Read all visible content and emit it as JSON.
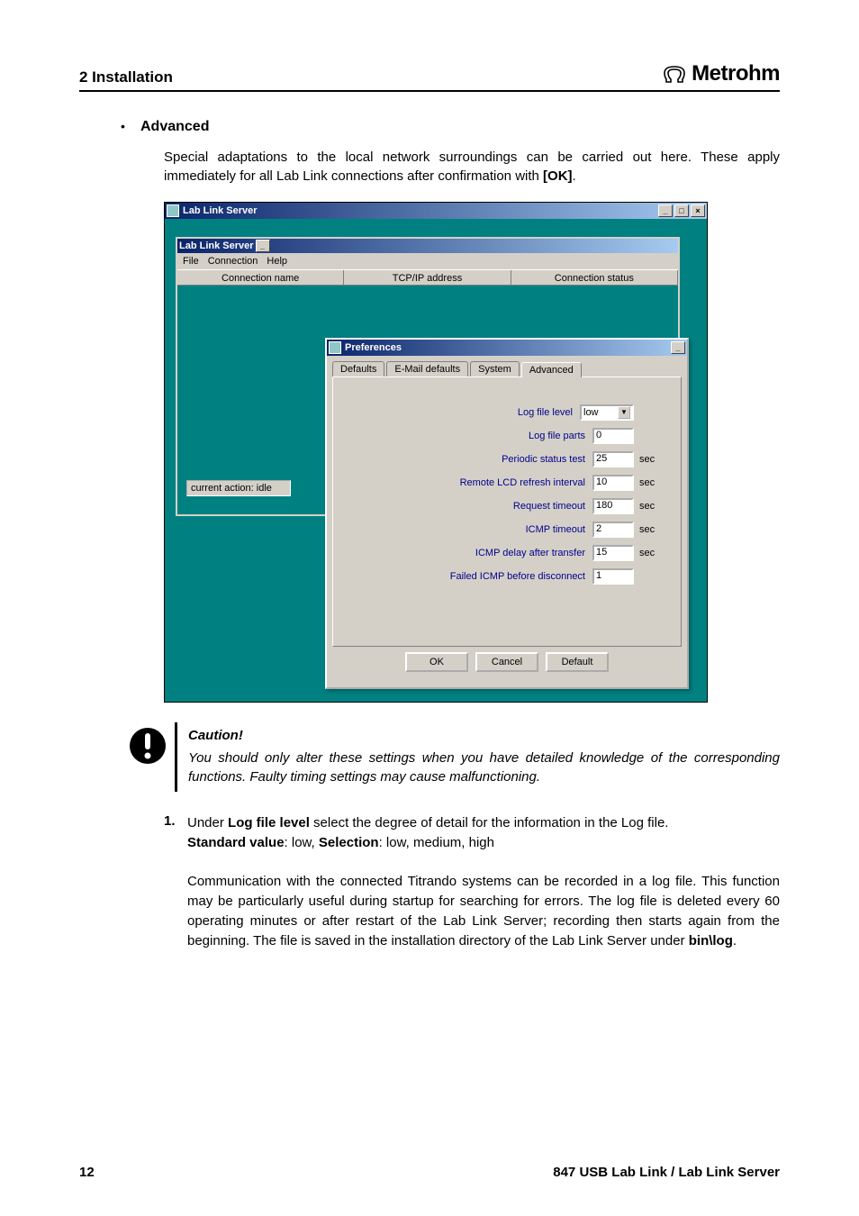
{
  "header": {
    "section": "2 Installation",
    "brand": "Metrohm"
  },
  "bullet": {
    "label": "Advanced"
  },
  "intro": "Special adaptations to the local network surroundings can be carried out here. These apply immediately for all Lab Link connections after confirmation with ",
  "intro_bold": "[OK]",
  "intro_tail": ".",
  "outer_window": {
    "title": "Lab Link Server"
  },
  "inner_window": {
    "title": "Lab Link Server",
    "menu": [
      "File",
      "Connection",
      "Help"
    ],
    "columns": [
      "Connection name",
      "TCP/IP address",
      "Connection status"
    ],
    "status": "current action:   idle"
  },
  "prefs": {
    "title": "Preferences",
    "tabs": [
      "Defaults",
      "E-Mail defaults",
      "System",
      "Advanced"
    ],
    "active_tab": 3,
    "fields": [
      {
        "label": "Log file level",
        "type": "select",
        "value": "low",
        "unit": ""
      },
      {
        "label": "Log file parts",
        "type": "input",
        "value": "0",
        "unit": ""
      },
      {
        "label": "Periodic status test",
        "type": "input",
        "value": "25",
        "unit": "sec"
      },
      {
        "label": "Remote LCD refresh interval",
        "type": "input",
        "value": "10",
        "unit": "sec"
      },
      {
        "label": "Request timeout",
        "type": "input",
        "value": "180",
        "unit": "sec"
      },
      {
        "label": "ICMP timeout",
        "type": "input",
        "value": "2",
        "unit": "sec"
      },
      {
        "label": "ICMP delay after transfer",
        "type": "input",
        "value": "15",
        "unit": "sec"
      },
      {
        "label": "Failed ICMP before disconnect",
        "type": "input",
        "value": "1",
        "unit": ""
      }
    ],
    "buttons": [
      "OK",
      "Cancel",
      "Default"
    ]
  },
  "caution": {
    "title": "Caution!",
    "text": "You should only alter these settings when you have detailed knowledge of the corresponding functions. Faulty timing settings may cause malfunctioning."
  },
  "list": {
    "num": "1.",
    "p1a": "Under ",
    "p1b": "Log file level",
    "p1c": " select the degree of detail for the information in the Log file.",
    "p2a": "Standard value",
    "p2b": ": low, ",
    "p2c": "Selection",
    "p2d": ": low, medium, high",
    "p3a": "Communication with the connected Titrando systems can be recorded in a log file. This function may be particularly useful during startup for searching for errors. The log file is deleted every 60 operating minutes or after restart of the Lab Link Server; recording then starts again from the beginning. The file is saved in the installation directory of the Lab Link Server under ",
    "p3b": "bin\\log",
    "p3c": "."
  },
  "footer": {
    "page": "12",
    "doc": "847 USB Lab Link / Lab Link Server"
  }
}
